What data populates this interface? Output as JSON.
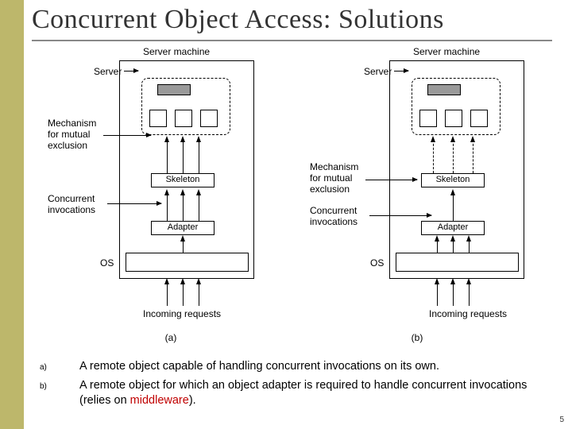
{
  "title": "Concurrent Object Access: Solutions",
  "diagram_labels": {
    "server_machine": "Server machine",
    "server": "Server",
    "mechanism": "Mechanism\nfor mutual\nexclusion",
    "concurrent": "Concurrent\ninvocations",
    "skeleton": "Skeleton",
    "adapter": "Adapter",
    "os": "OS",
    "incoming": "Incoming requests"
  },
  "captions": {
    "a": "(a)",
    "b": "(b)"
  },
  "items": {
    "a": {
      "key": "a)",
      "text_before": "A remote object capable of handling concurrent invocations on its own.",
      "text_mw": "",
      "text_after": ""
    },
    "b": {
      "key": "b)",
      "text_before": "A remote object for which an object adapter is required to handle concurrent invocations (relies on ",
      "text_mw": "middleware",
      "text_after": ")."
    }
  },
  "page_number": "5"
}
